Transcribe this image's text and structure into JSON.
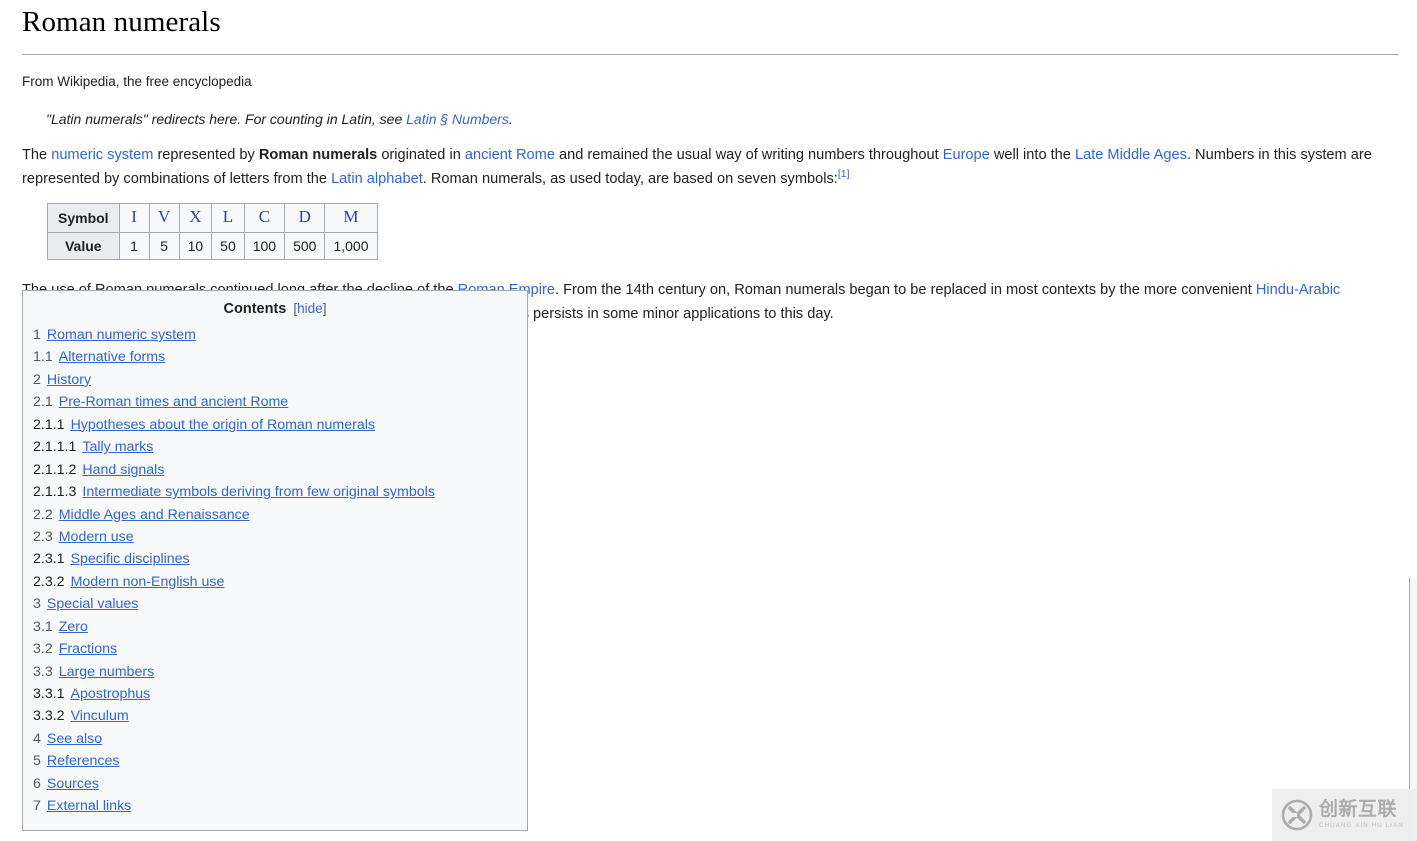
{
  "page": {
    "title": "Roman numerals",
    "subtitle": "From Wikipedia, the free encyclopedia",
    "hatnote": {
      "before": "\"Latin numerals\" redirects here. For counting in Latin, see ",
      "link": "Latin § Numbers",
      "after": "."
    },
    "paragraph1": {
      "t1": "The ",
      "l1": "numeric system",
      "t2": " represented by ",
      "b1": "Roman numerals",
      "t3": " originated in ",
      "l2": "ancient Rome",
      "t4": " and remained the usual way of writing numbers throughout ",
      "l3": "Europe",
      "t5": " well into the ",
      "l4": "Late Middle Ages",
      "t6": ". Numbers in this system are represented by combinations of letters from the ",
      "l5": "Latin alphabet",
      "t7": ". Roman numerals, as used today, are based on seven symbols:",
      "ref": "[1]"
    },
    "paragraph2": {
      "t1": "The use of Roman numerals continued long after the decline of the ",
      "l1": "Roman Empire",
      "t2": ". From the 14th century on, Roman numerals began to be replaced in most contexts by the more convenient ",
      "l2": "Hindu-Arabic numerals",
      "t3": "; however, this process was gradual, and the use of Roman numerals persists in some minor applications to this day."
    }
  },
  "symbol_table": {
    "row_headers": [
      "Symbol",
      "Value"
    ],
    "symbols": [
      "I",
      "V",
      "X",
      "L",
      "C",
      "D",
      "M"
    ],
    "values": [
      "1",
      "5",
      "10",
      "50",
      "100",
      "500",
      "1,000"
    ]
  },
  "toc": {
    "heading": "Contents",
    "toggle_open": "[",
    "toggle_label": "hide",
    "toggle_close": "]",
    "items": [
      {
        "number": "1",
        "text": "Roman numeric system",
        "level": 1
      },
      {
        "number": "1.1",
        "text": "Alternative forms",
        "level": 2
      },
      {
        "number": "2",
        "text": "History",
        "level": 1
      },
      {
        "number": "2.1",
        "text": "Pre-Roman times and ancient Rome",
        "level": 2
      },
      {
        "number": "2.1.1",
        "text": "Hypotheses about the origin of Roman numerals",
        "level": 3
      },
      {
        "number": "2.1.1.1",
        "text": "Tally marks",
        "level": 4
      },
      {
        "number": "2.1.1.2",
        "text": "Hand signals",
        "level": 4
      },
      {
        "number": "2.1.1.3",
        "text": "Intermediate symbols deriving from few original symbols",
        "level": 4
      },
      {
        "number": "2.2",
        "text": "Middle Ages and Renaissance",
        "level": 2
      },
      {
        "number": "2.3",
        "text": "Modern use",
        "level": 2
      },
      {
        "number": "2.3.1",
        "text": "Specific disciplines",
        "level": 3
      },
      {
        "number": "2.3.2",
        "text": "Modern non-English use",
        "level": 3
      },
      {
        "number": "3",
        "text": "Special values",
        "level": 1
      },
      {
        "number": "3.1",
        "text": "Zero",
        "level": 2
      },
      {
        "number": "3.2",
        "text": "Fractions",
        "level": 2
      },
      {
        "number": "3.3",
        "text": "Large numbers",
        "level": 2
      },
      {
        "number": "3.3.1",
        "text": "Apostrophus",
        "level": 3
      },
      {
        "number": "3.3.2",
        "text": "Vinculum",
        "level": 3
      },
      {
        "number": "4",
        "text": "See also",
        "level": 1
      },
      {
        "number": "5",
        "text": "References",
        "level": 1
      },
      {
        "number": "6",
        "text": "Sources",
        "level": 1
      },
      {
        "number": "7",
        "text": "External links",
        "level": 1
      }
    ]
  },
  "watermark": {
    "logo": "circled-x-logo",
    "chinese": "创新互联",
    "pinyin": "CHUANG XIN HU LIAN"
  },
  "colors": {
    "link": "#3366cc",
    "text": "#202122",
    "border": "#a2a9b1",
    "table_header_bg": "#eaecf0",
    "panel_bg": "#f8f9fa",
    "symbol_blue": "#2b43a8",
    "toc_number": "#54595d"
  }
}
